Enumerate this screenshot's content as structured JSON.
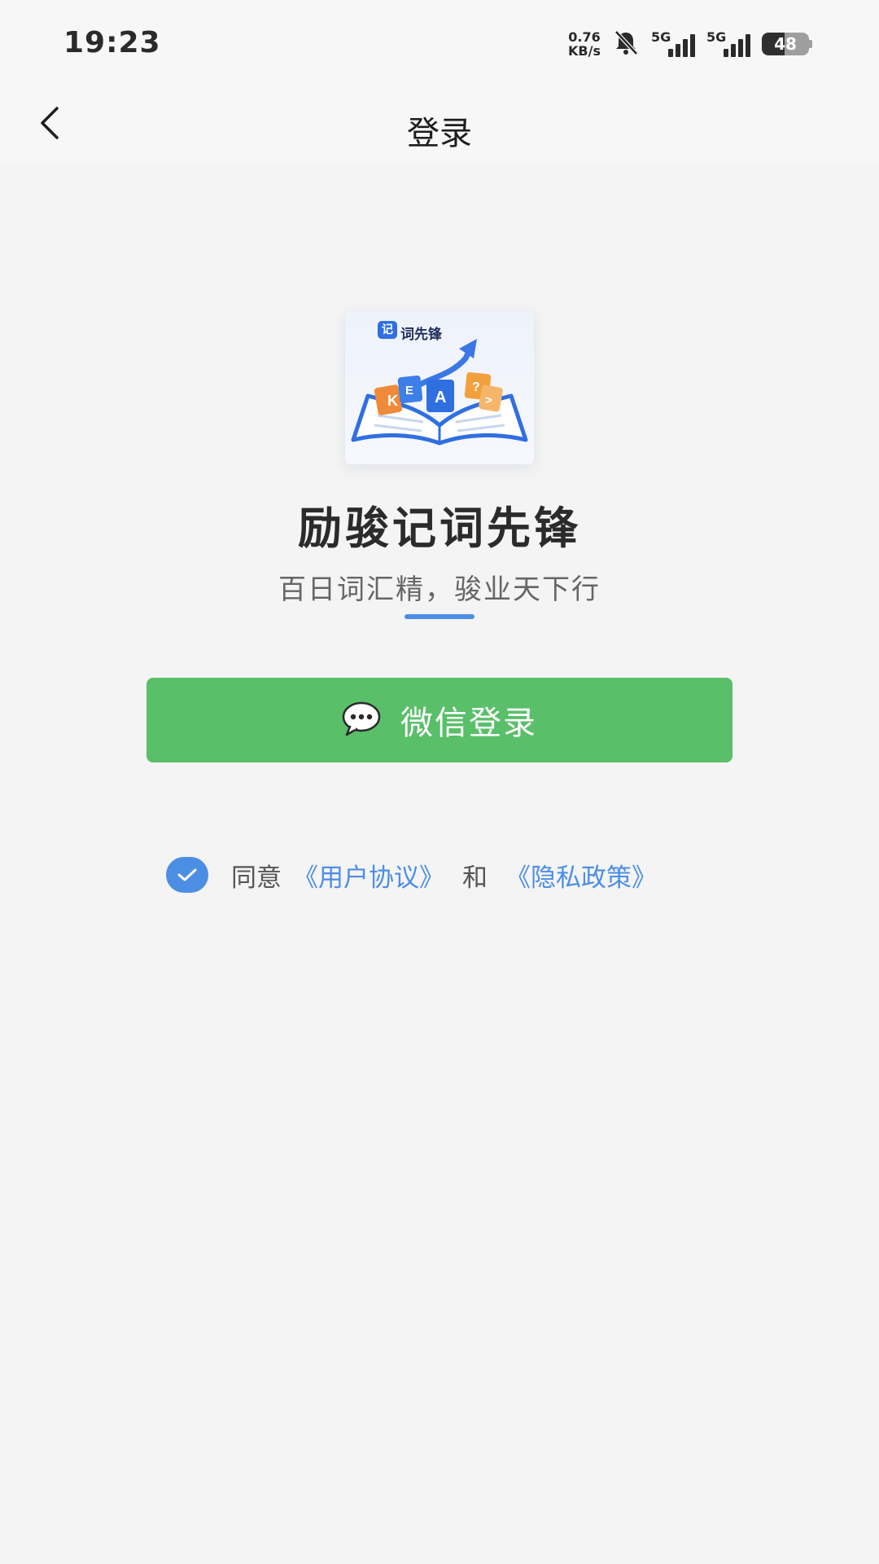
{
  "status_bar": {
    "time": "19:23",
    "net_speed_value": "0.76",
    "net_speed_unit": "KB/s",
    "sim1_label": "5G",
    "sim2_label": "5G",
    "battery": "48"
  },
  "nav": {
    "title": "登录",
    "back_icon": "chevron-left-icon"
  },
  "logo": {
    "badge": "记",
    "brand": "词先锋",
    "cards": [
      "K",
      "A",
      "E",
      "?",
      ">"
    ]
  },
  "app": {
    "name": "励骏记词先锋",
    "slogan": "百日词汇精，骏业天下行"
  },
  "login": {
    "wechat_label": "微信登录",
    "icon": "wechat-chat-icon"
  },
  "agreement": {
    "checked": true,
    "agree_text": "同意",
    "user_agreement": "《用户协议》",
    "and_text": "和",
    "privacy_policy": "《隐私政策》"
  },
  "colors": {
    "accent_blue": "#4d8ee5",
    "wechat_green": "#59bf69",
    "background": "#f4f4f4"
  }
}
